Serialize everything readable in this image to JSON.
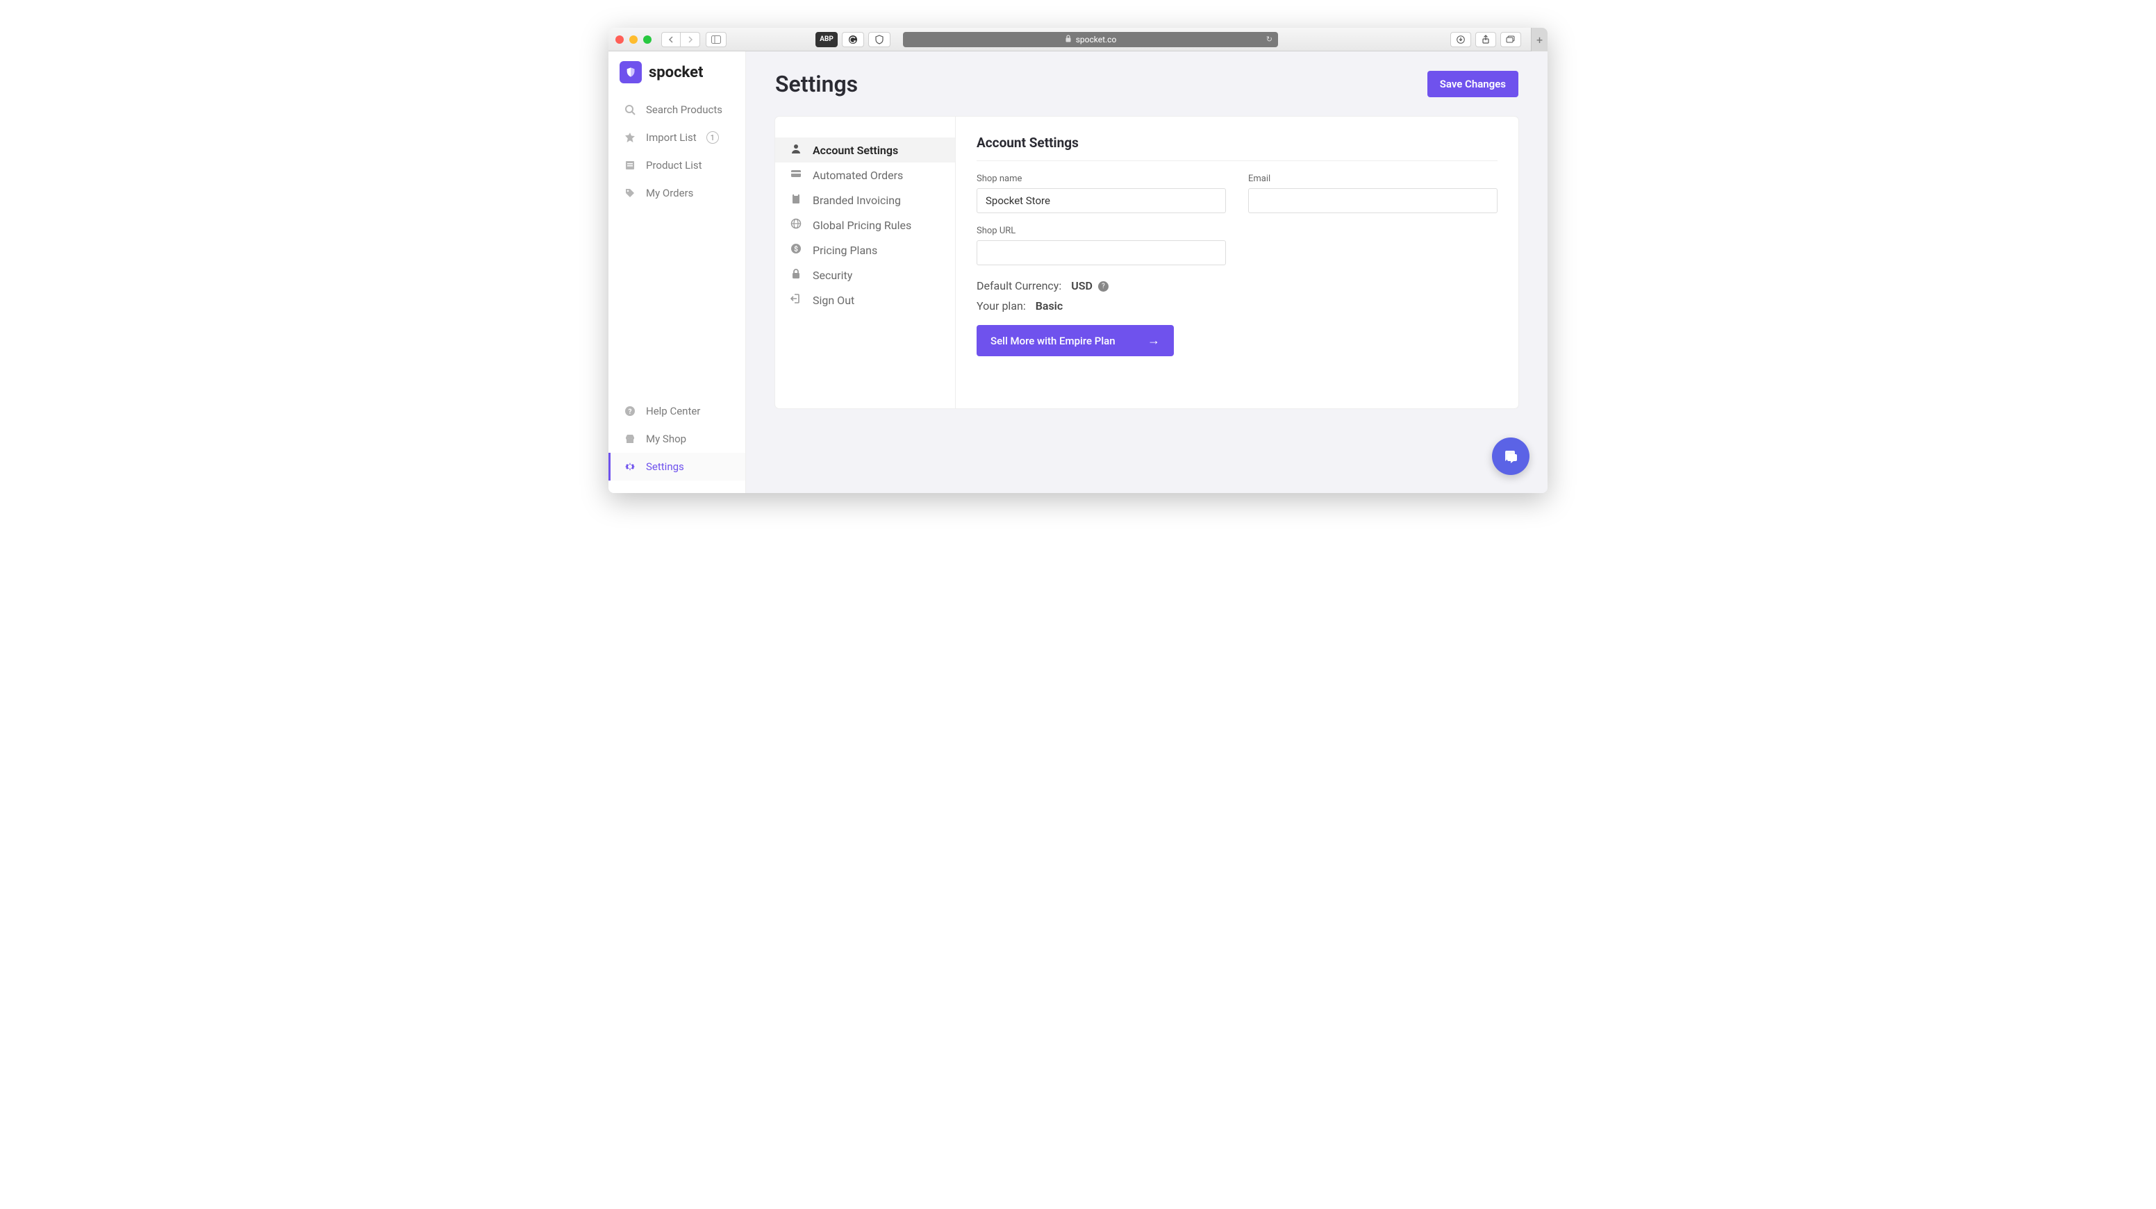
{
  "browser": {
    "url_host": "spocket.co",
    "adblock_label": "ABP"
  },
  "brand": {
    "name": "spocket"
  },
  "sidebar": {
    "top": [
      {
        "label": "Search Products"
      },
      {
        "label": "Import List",
        "badge": "1"
      },
      {
        "label": "Product List"
      },
      {
        "label": "My Orders"
      }
    ],
    "bottom": [
      {
        "label": "Help Center"
      },
      {
        "label": "My Shop"
      },
      {
        "label": "Settings",
        "active": true
      }
    ]
  },
  "page": {
    "title": "Settings",
    "save_label": "Save Changes"
  },
  "settings_nav": [
    {
      "label": "Account Settings",
      "active": true
    },
    {
      "label": "Automated Orders"
    },
    {
      "label": "Branded Invoicing"
    },
    {
      "label": "Global Pricing Rules"
    },
    {
      "label": "Pricing Plans"
    },
    {
      "label": "Security"
    },
    {
      "label": "Sign Out"
    }
  ],
  "account": {
    "heading": "Account Settings",
    "shop_name_label": "Shop name",
    "shop_name_value": "Spocket Store",
    "email_label": "Email",
    "email_value": "",
    "shop_url_label": "Shop URL",
    "shop_url_value": "",
    "currency_label": "Default Currency:",
    "currency_value": "USD",
    "plan_label": "Your plan:",
    "plan_value": "Basic",
    "cta_label": "Sell More with Empire Plan"
  },
  "colors": {
    "primary": "#6f52ed"
  }
}
